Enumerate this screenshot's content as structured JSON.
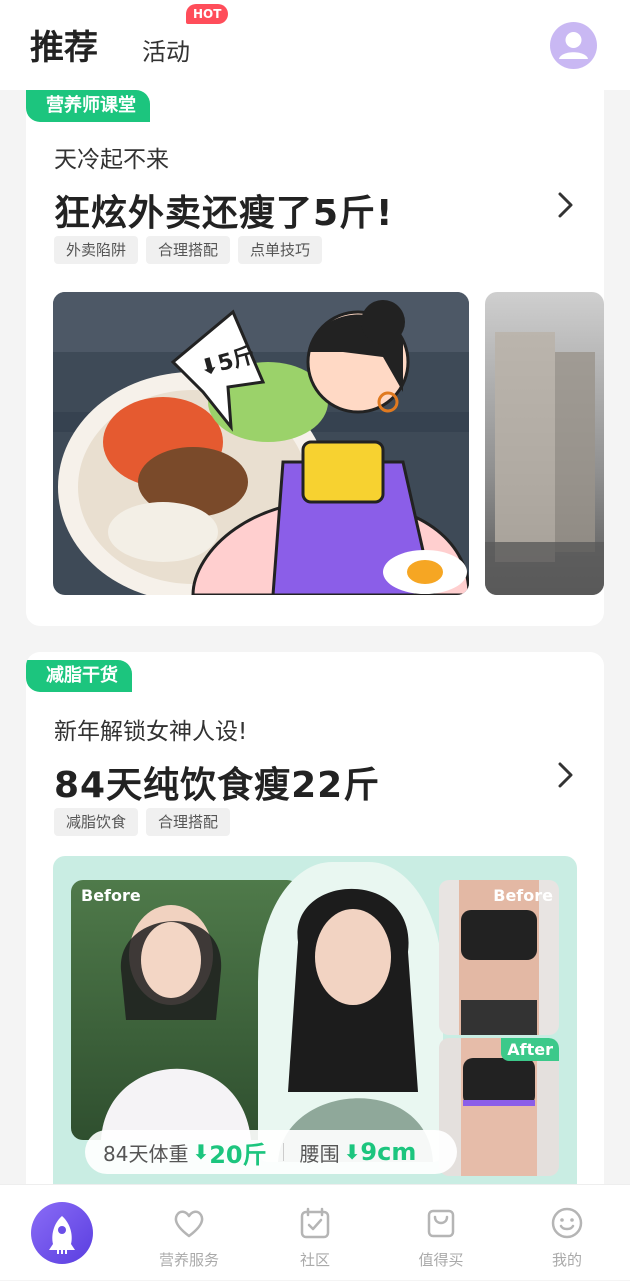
{
  "header": {
    "tab_recommend": "推荐",
    "tab_activity": "活动",
    "hot_badge": "HOT",
    "avatar_icon": "user-avatar-icon"
  },
  "cards": [
    {
      "label": "营养师课堂",
      "subtitle": "天冷起不来",
      "title": "狂炫外卖还瘦了5斤!",
      "chips": [
        "外卖陷阱",
        "合理搭配",
        "点单技巧"
      ],
      "image_badge": "⬇5斤"
    },
    {
      "label": "减脂干货",
      "subtitle": "新年解锁女神人设!",
      "title": "84天纯饮食瘦22斤",
      "chips": [
        "减脂饮食",
        "合理搭配"
      ],
      "before_left": "Before",
      "before_right": "Before",
      "after_right": "After",
      "stat_weight_label": "84天体重",
      "stat_weight_value": "20斤",
      "stat_waist_label": "腰围",
      "stat_waist_value": "9cm"
    }
  ],
  "nav": {
    "items": [
      {
        "label": "",
        "icon": "rocket-home-icon"
      },
      {
        "label": "营养服务",
        "icon": "heart-icon"
      },
      {
        "label": "社区",
        "icon": "calendar-check-icon"
      },
      {
        "label": "值得买",
        "icon": "shopping-bag-icon"
      },
      {
        "label": "我的",
        "icon": "smiley-icon"
      }
    ]
  },
  "colors": {
    "accent_green": "#1cc57e",
    "hot_red": "#ff4d5a",
    "nav_purple": "#6b4fe8"
  }
}
